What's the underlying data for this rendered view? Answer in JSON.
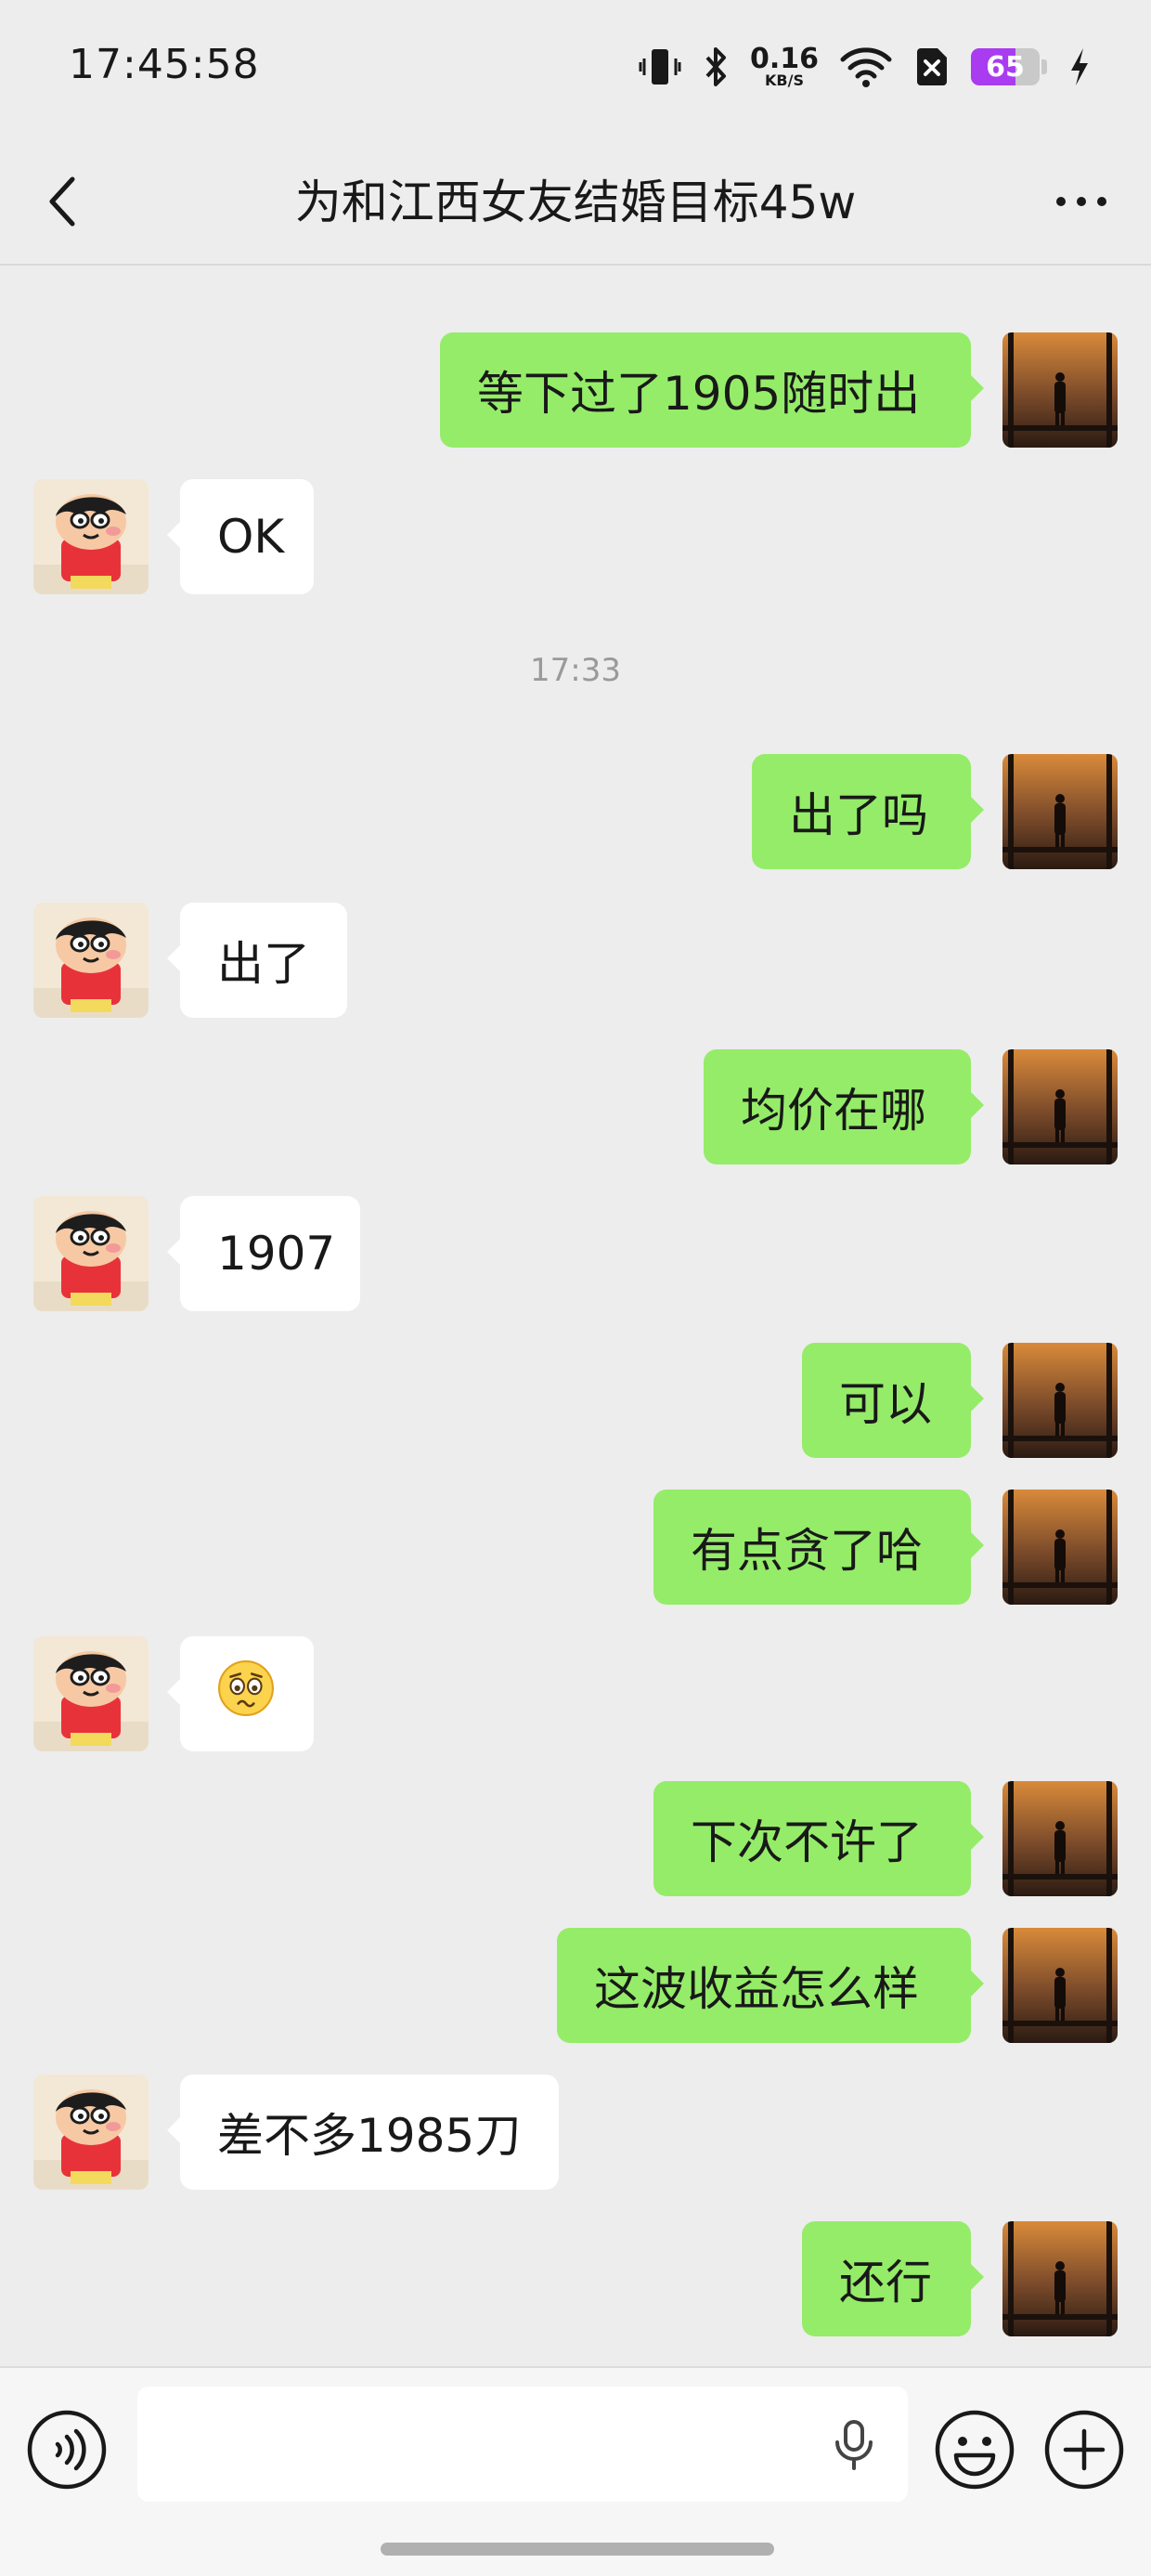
{
  "status_bar": {
    "time": "17:45:58",
    "net_speed_value": "0.16",
    "net_speed_unit": "KB/S",
    "battery_percent": "65"
  },
  "header": {
    "title": "为和江西女友结婚目标45w"
  },
  "chat": {
    "timestamp": "17:33",
    "messages": [
      {
        "side": "in",
        "text": ""
      },
      {
        "side": "out",
        "text": "等下过了1905随时出"
      },
      {
        "side": "in",
        "text": "OK"
      },
      {
        "side": "out",
        "text": "出了吗"
      },
      {
        "side": "in",
        "text": "出了"
      },
      {
        "side": "out",
        "text": "均价在哪"
      },
      {
        "side": "in",
        "text": "1907"
      },
      {
        "side": "out",
        "text": "可以"
      },
      {
        "side": "out",
        "text": "有点贪了哈"
      },
      {
        "side": "in",
        "text": "",
        "emoji": "worried-face"
      },
      {
        "side": "out",
        "text": "下次不许了"
      },
      {
        "side": "out",
        "text": "这波收益怎么样"
      },
      {
        "side": "in",
        "text": "差不多1985刀"
      },
      {
        "side": "out",
        "text": "还行"
      }
    ]
  },
  "input_bar": {
    "placeholder": ""
  },
  "colors": {
    "bg": "#ededed",
    "outgoing": "#95ec69",
    "incoming": "#ffffff",
    "battery": "#a93cf0"
  }
}
